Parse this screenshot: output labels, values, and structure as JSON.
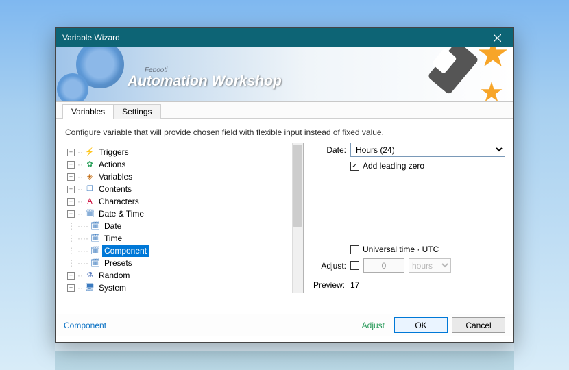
{
  "window": {
    "title": "Variable Wizard"
  },
  "banner": {
    "brand": "Febooti",
    "product": "Automation Workshop"
  },
  "tabs": {
    "variables": "Variables",
    "settings": "Settings"
  },
  "instruction": "Configure variable that will provide chosen field with flexible input instead of fixed value.",
  "tree": {
    "triggers": "Triggers",
    "actions": "Actions",
    "variables": "Variables",
    "contents": "Contents",
    "characters": "Characters",
    "datetime": "Date & Time",
    "date": "Date",
    "time": "Time",
    "component": "Component",
    "presets": "Presets",
    "random": "Random",
    "system": "System"
  },
  "right": {
    "date_label": "Date:",
    "date_value": "Hours (24)",
    "leading_zero": "Add leading zero",
    "leading_zero_checked": "✓",
    "utc": "Universal time · UTC",
    "adjust_label": "Adjust:",
    "adjust_value": "0",
    "adjust_unit": "hours",
    "preview_label": "Preview:",
    "preview_value": "17"
  },
  "footer": {
    "link": "Component",
    "adjust": "Adjust",
    "ok": "OK",
    "cancel": "Cancel"
  }
}
